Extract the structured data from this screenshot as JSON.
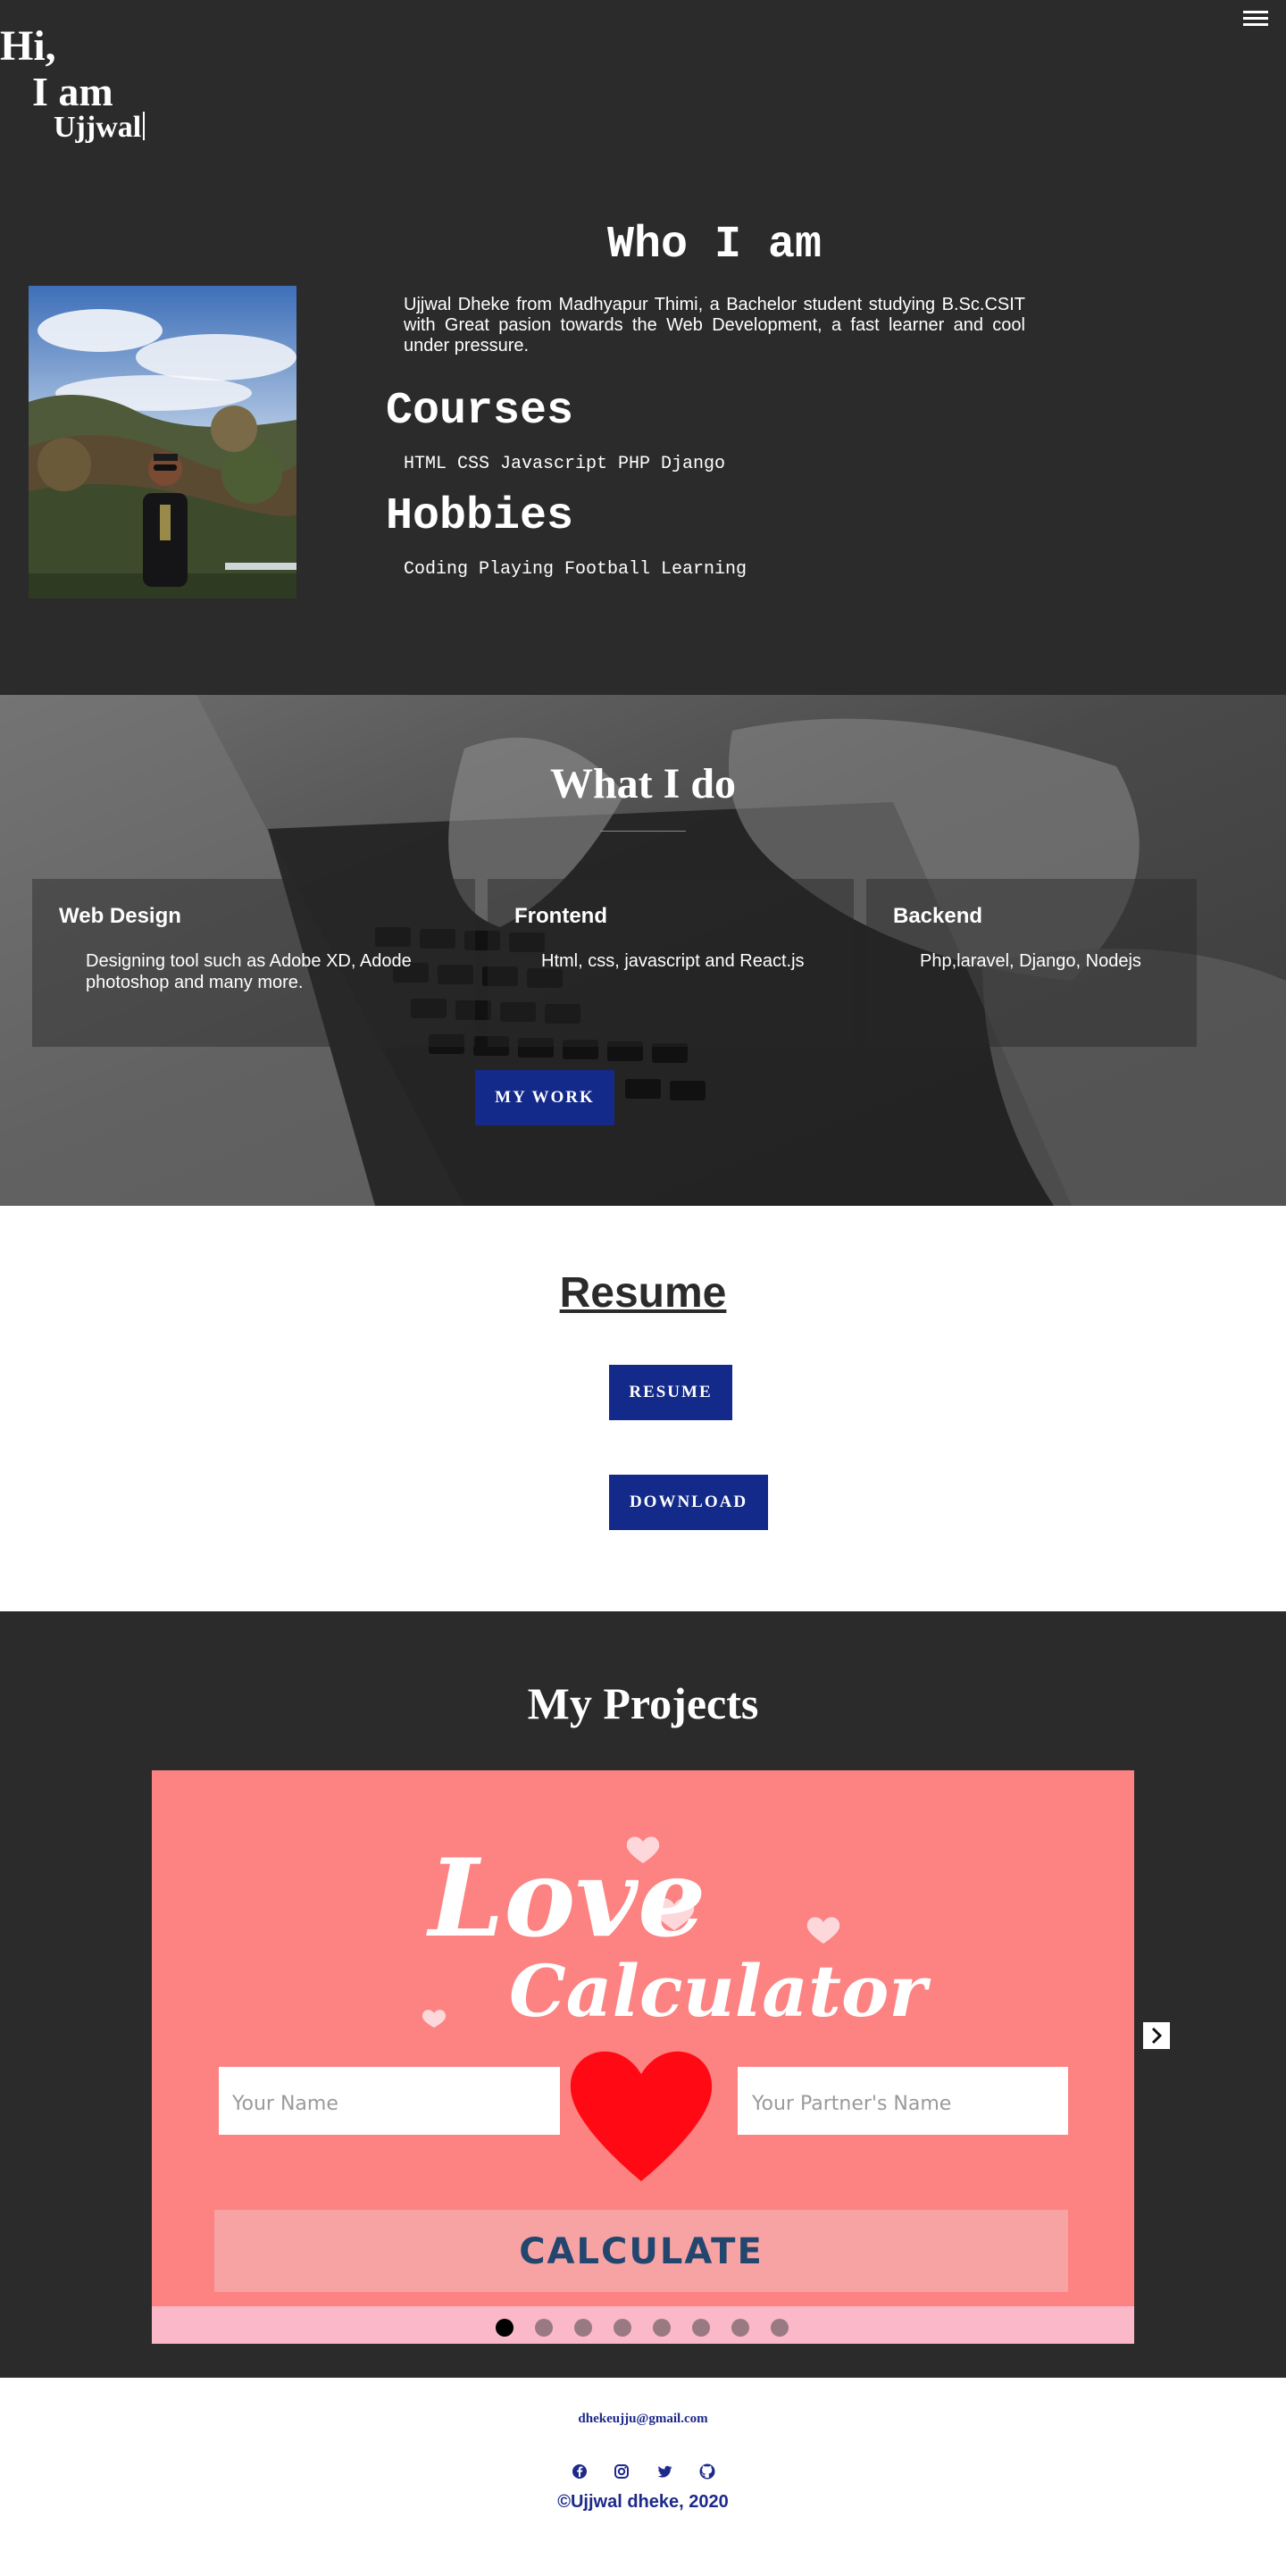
{
  "hero": {
    "greeting_line1": "Hi,",
    "greeting_line2": "I am",
    "greeting_line3": "Ujjwal",
    "menu_icon": "hamburger-icon"
  },
  "about": {
    "title": "Who I am",
    "description": "Ujjwal Dheke from Madhyapur Thimi, a Bachelor student studying B.Sc.CSIT with Great pasion towards the Web Development, a fast learner and cool under pressure.",
    "courses_heading": "Courses",
    "courses": "HTML CSS Javascript PHP Django",
    "hobbies_heading": "Hobbies",
    "hobbies": "Coding Playing Football Learning"
  },
  "services": {
    "title": "What I do",
    "cards": [
      {
        "title": "Web Design",
        "description": "Designing tool such as Adobe XD, Adode photoshop and many more."
      },
      {
        "title": "Frontend",
        "description": "Html, css, javascript and React.js"
      },
      {
        "title": "Backend",
        "description": "Php,laravel, Django, Nodejs"
      }
    ],
    "my_work_label": "MY WORK"
  },
  "resume": {
    "title": "Resume",
    "resume_label": "RESUME",
    "download_label": "DOWNLOAD"
  },
  "projects": {
    "title": "My Projects",
    "slide": {
      "logo_line1": "Love",
      "logo_line2": "Calculator",
      "name_placeholder": "Your Name",
      "partner_placeholder": "Your Partner's Name",
      "calculate_label": "CALCULATE"
    },
    "active_slide": 1,
    "slide_count": 8
  },
  "footer": {
    "email": "dhekeujju@gmail.com",
    "social_icons": [
      "facebook-icon",
      "instagram-icon",
      "twitter-icon",
      "github-icon"
    ],
    "copyright": "©Ujjwal dheke, 2020"
  },
  "colors": {
    "dark_bg": "#2b2b2b",
    "button_blue": "#142a8a",
    "footer_blue": "#1d2a8a",
    "slide_pink": "#fd8282"
  }
}
